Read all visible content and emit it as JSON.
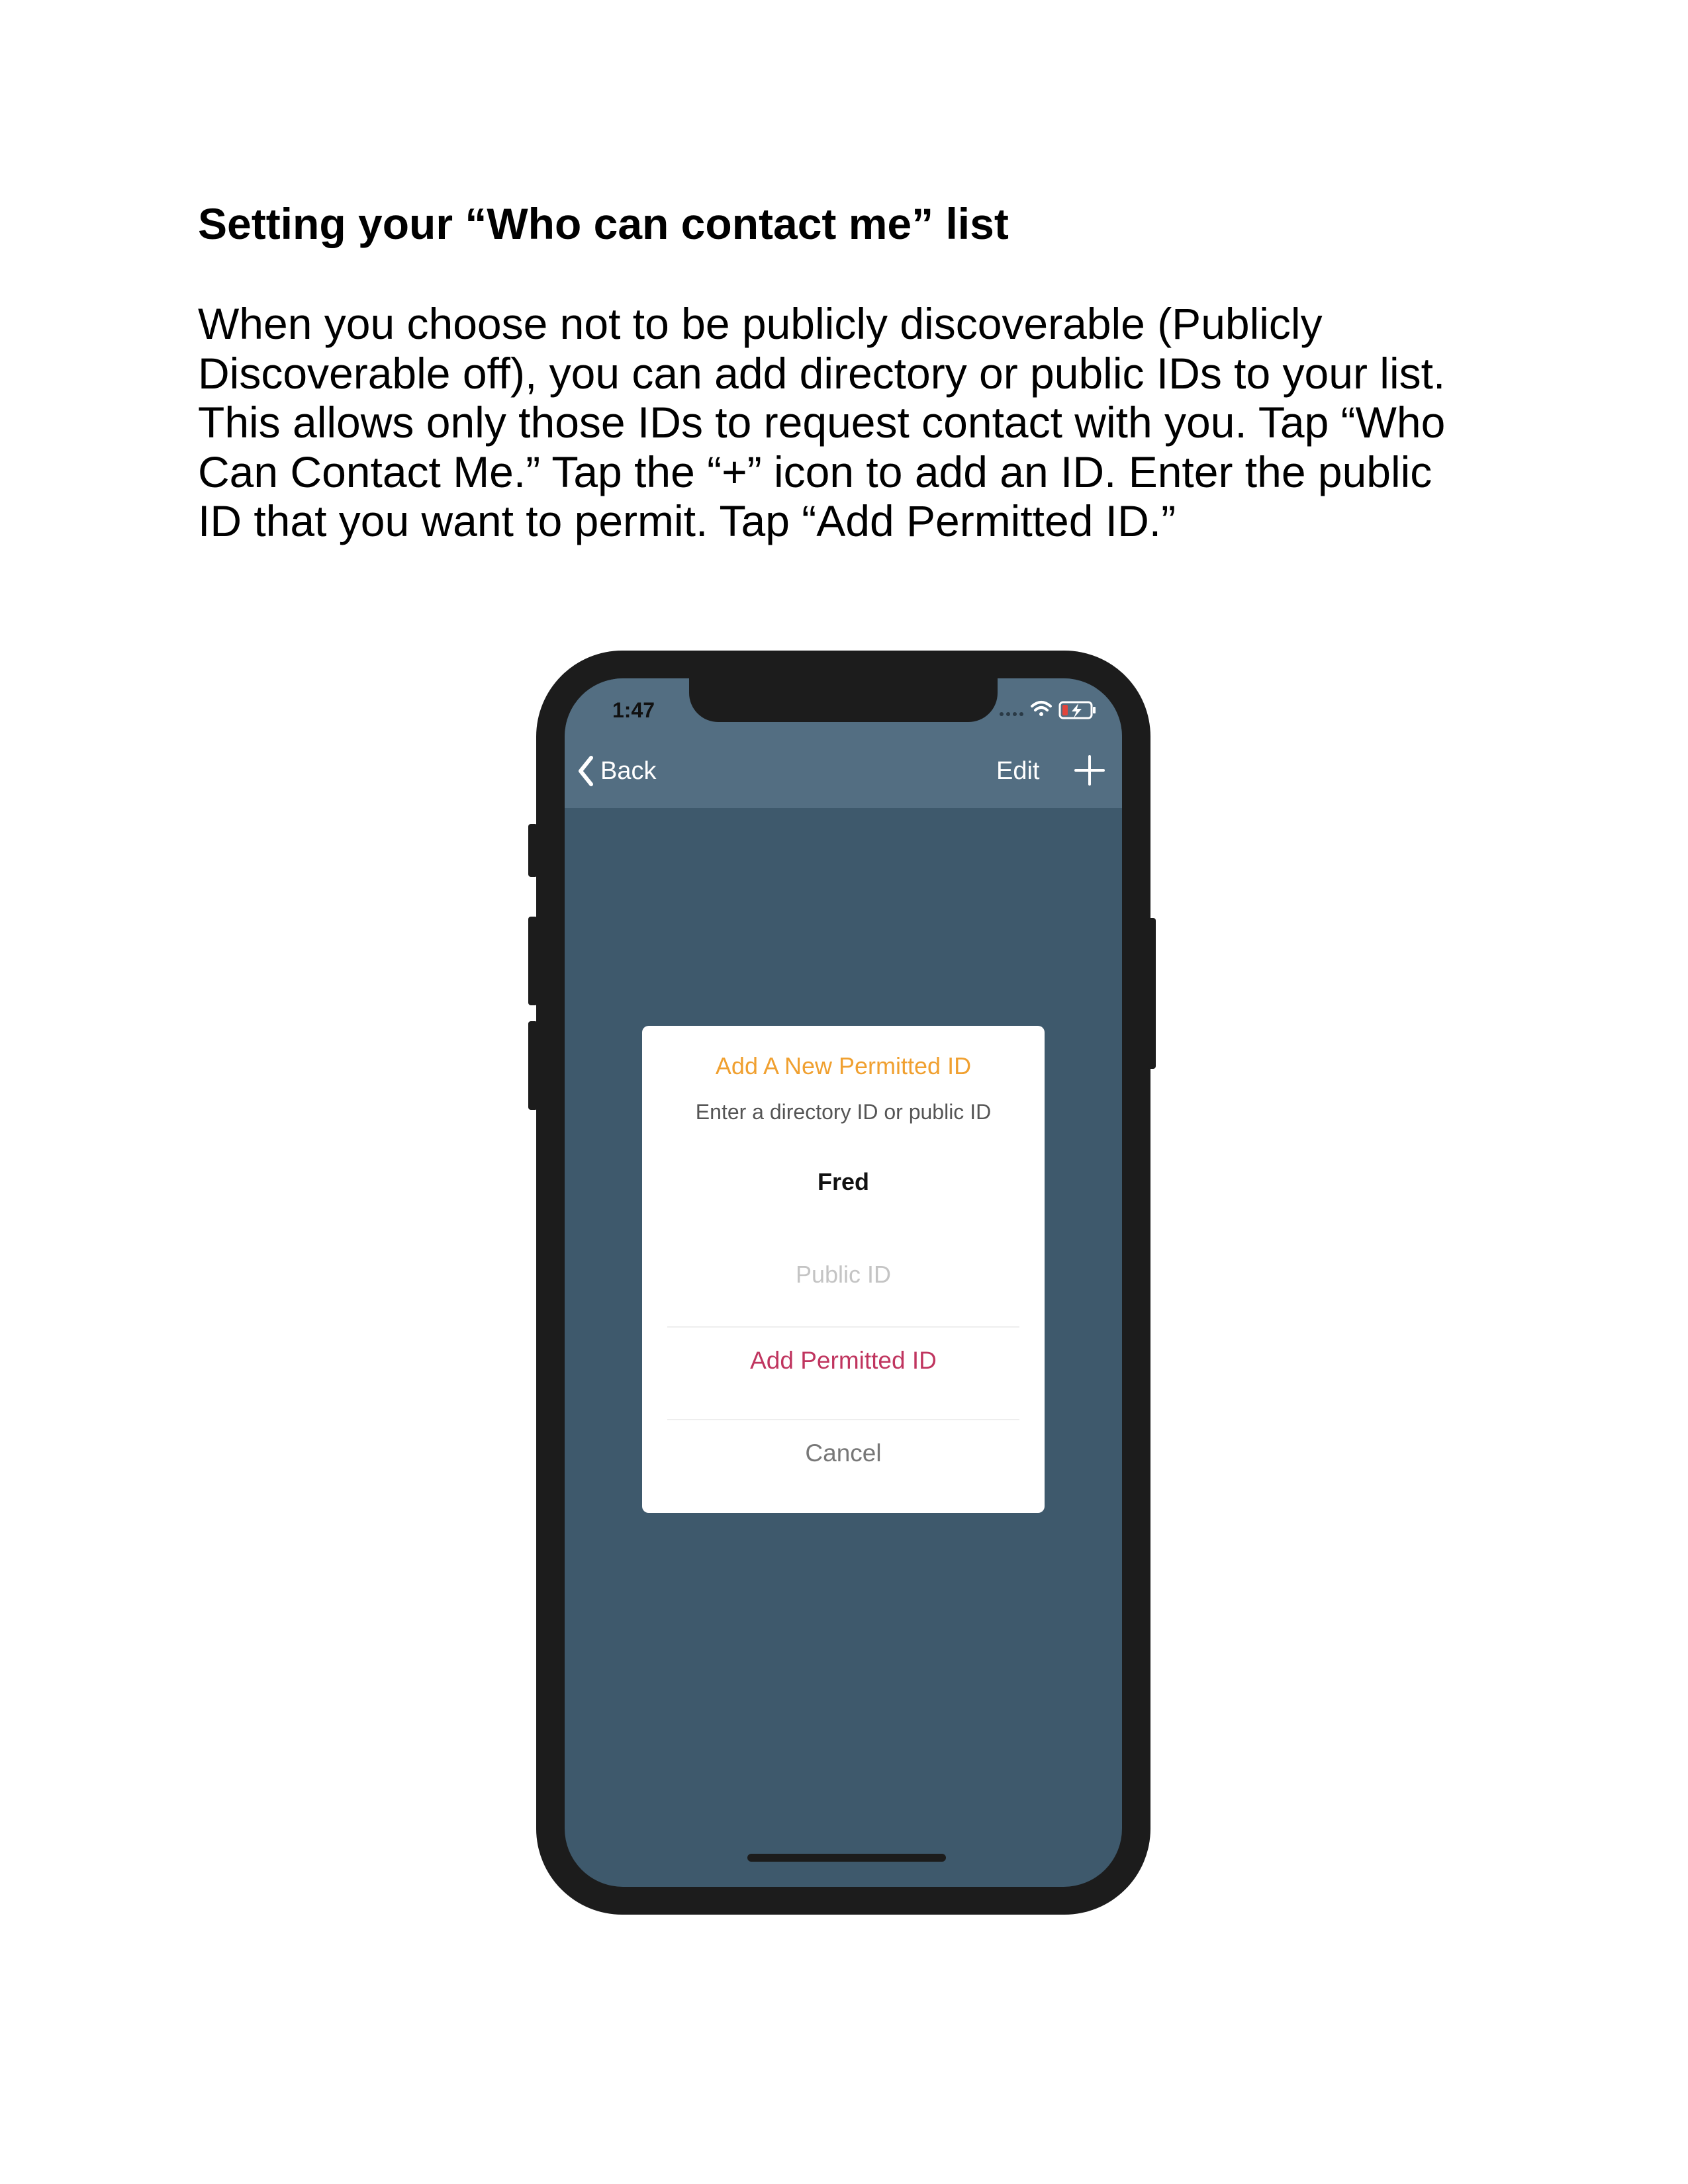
{
  "document": {
    "title": "Setting your “Who can contact me” list",
    "body_lines": [
      "When you choose not to be publicly discoverable (Publicly",
      "Discoverable off), you can add directory or public IDs to your list.",
      "This allows only those IDs to request contact with you. Tap “Who",
      "Can Contact Me.” Tap the “+” icon to add an ID. Enter the public",
      "ID that you want to permit. Tap “Add Permitted ID.”"
    ]
  },
  "phone": {
    "status_bar": {
      "time": "1:47",
      "icons": [
        "signal-dots-icon",
        "wifi-icon",
        "battery-charging-icon"
      ]
    },
    "nav": {
      "back_label": "Back",
      "edit_label": "Edit",
      "add_icon": "plus-icon"
    },
    "dialog": {
      "title": "Add A New Permitted ID",
      "message": "Enter a directory ID or public ID",
      "name_value": "Fred",
      "public_id_placeholder": "Public ID",
      "add_button": "Add Permitted ID",
      "cancel_button": "Cancel"
    }
  },
  "colors": {
    "screen_bg": "#3e596c",
    "navbar_bg": "#536e82",
    "phone_frame": "#1c1c1c",
    "dialog_title": "#f0a030",
    "add_button": "#c0355f",
    "cancel_button": "#777777",
    "placeholder": "#c4c4c4"
  }
}
